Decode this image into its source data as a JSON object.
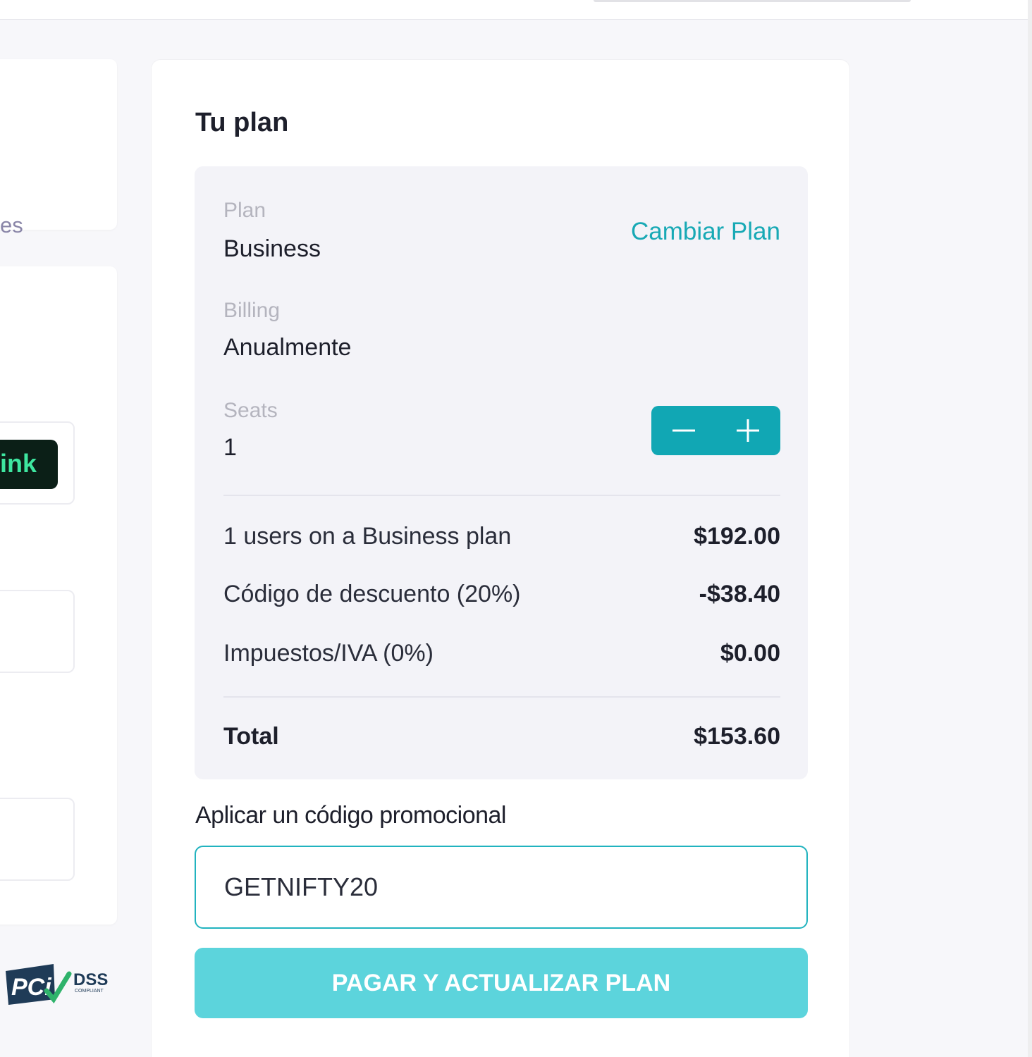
{
  "left_column": {
    "card_fragment": "es",
    "link_fragment": "ink",
    "pci_badge": {
      "text_large": "PCi",
      "text_dss": "DSS",
      "text_compliant": "COMPLIANT"
    }
  },
  "plan_card": {
    "title": "Tu plan",
    "plan": {
      "label": "Plan",
      "value": "Business",
      "change_link": "Cambiar Plan"
    },
    "billing": {
      "label": "Billing",
      "value": "Anualmente"
    },
    "seats": {
      "label": "Seats",
      "value": "1",
      "decrement_icon": "minus-icon",
      "increment_icon": "plus-icon"
    },
    "line_items": [
      {
        "label": "1 users on a Business plan",
        "amount": "$192.00"
      },
      {
        "label": "Código de descuento (20%)",
        "amount": "-$38.40"
      },
      {
        "label": "Impuestos/IVA (0%)",
        "amount": "$0.00"
      }
    ],
    "total": {
      "label": "Total",
      "amount": "$153.60"
    },
    "promo": {
      "label": "Aplicar un código promocional",
      "value": "GETNIFTY20"
    },
    "pay_button": "PAGAR Y ACTUALIZAR PLAN"
  },
  "colors": {
    "accent": "#11a7b4",
    "link": "#18a9b5",
    "pay_button": "#5cd4dc",
    "panel_bg": "#f3f3f8"
  }
}
